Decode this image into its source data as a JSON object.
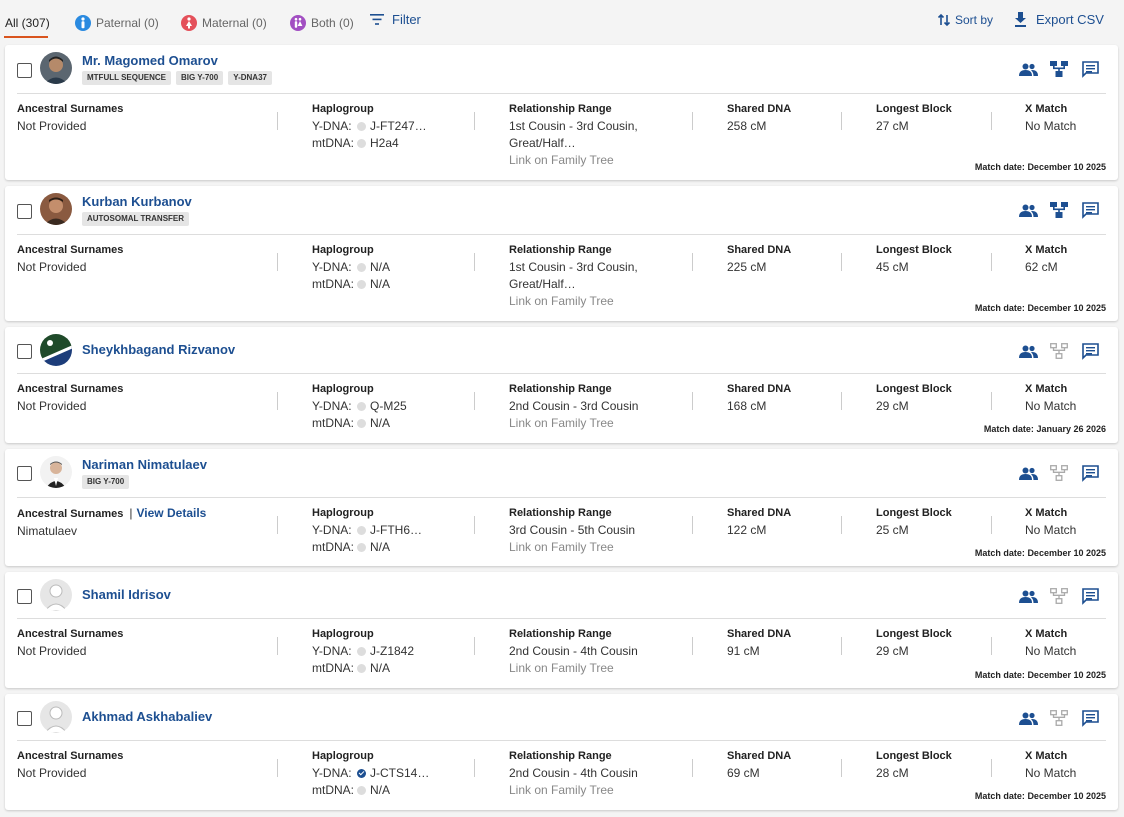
{
  "tabs": [
    {
      "label": "All (307)",
      "active": true,
      "icon": "none"
    },
    {
      "label": "Paternal (0)",
      "icon": "male-icon",
      "color": "#2a8ae0"
    },
    {
      "label": "Maternal (0)",
      "icon": "female-icon",
      "color": "#e4505a"
    },
    {
      "label": "Both (0)",
      "icon": "both-icon",
      "color": "#a24fc2"
    }
  ],
  "toolbar": {
    "filter_label": "Filter",
    "sort_label": "Sort by",
    "export_label": "Export CSV"
  },
  "colors": {
    "accent": "#1d4f91",
    "tab_underline": "#d9541e"
  },
  "column_labels": {
    "surnames": "Ancestral Surnames",
    "haplogroup": "Haplogroup",
    "relationship": "Relationship Range",
    "shared": "Shared DNA",
    "longest": "Longest Block",
    "xmatch": "X Match",
    "ydna": "Y-DNA:",
    "mtdna": "mtDNA:",
    "link_tree": "Link on Family Tree",
    "view_details": "View Details",
    "match_date_prefix": "Match date:"
  },
  "matches": [
    {
      "name": "Mr. Magomed Omarov",
      "badges": [
        "MTFULL SEQUENCE",
        "BIG Y-700",
        "Y-DNA37"
      ],
      "avatar": "photo",
      "surnames": "Not Provided",
      "ydna": "J-FT247…",
      "mtdna": "H2a4",
      "relationship": [
        "1st Cousin - 3rd Cousin,",
        "Great/Half…"
      ],
      "shared": "258 cM",
      "longest": "27 cM",
      "xmatch": "No Match",
      "match_date": "December 10 2025",
      "tree_active": true
    },
    {
      "name": "Kurban Kurbanov",
      "badges": [
        "AUTOSOMAL TRANSFER"
      ],
      "avatar": "photo",
      "surnames": "Not Provided",
      "ydna": "N/A",
      "mtdna": "N/A",
      "relationship": [
        "1st Cousin - 3rd Cousin,",
        "Great/Half…"
      ],
      "shared": "225 cM",
      "longest": "45 cM",
      "xmatch": "62 cM",
      "match_date": "December 10 2025",
      "tree_active": true
    },
    {
      "name": "Sheykhbagand Rizvanov",
      "badges": [],
      "avatar": "flag",
      "surnames": "Not Provided",
      "ydna": "Q-M25",
      "mtdna": "N/A",
      "relationship": [
        "2nd Cousin - 3rd Cousin"
      ],
      "shared": "168 cM",
      "longest": "29 cM",
      "xmatch": "No Match",
      "match_date": "January 26 2026",
      "tree_active": false
    },
    {
      "name": "Nariman Nimatulaev",
      "badges": [
        "BIG Y-700"
      ],
      "avatar": "photo",
      "surnames": "Nimatulaev",
      "view_details": true,
      "ydna": "J-FTH6…",
      "mtdna": "N/A",
      "relationship": [
        "3rd Cousin - 5th Cousin"
      ],
      "shared": "122 cM",
      "longest": "25 cM",
      "xmatch": "No Match",
      "match_date": "December 10 2025",
      "tree_active": false
    },
    {
      "name": "Shamil Idrisov",
      "badges": [],
      "avatar": "default",
      "surnames": "Not Provided",
      "ydna": "J-Z1842",
      "mtdna": "N/A",
      "relationship": [
        "2nd Cousin - 4th Cousin"
      ],
      "shared": "91 cM",
      "longest": "29 cM",
      "xmatch": "No Match",
      "match_date": "December 10 2025",
      "tree_active": false
    },
    {
      "name": "Akhmad Askhabaliev",
      "badges": [],
      "avatar": "default",
      "surnames": "Not Provided",
      "ydna": "J-CTS14…",
      "ydna_verified": true,
      "mtdna": "N/A",
      "relationship": [
        "2nd Cousin - 4th Cousin"
      ],
      "shared": "69 cM",
      "longest": "28 cM",
      "xmatch": "No Match",
      "match_date": "December 10 2025",
      "tree_active": false
    }
  ]
}
